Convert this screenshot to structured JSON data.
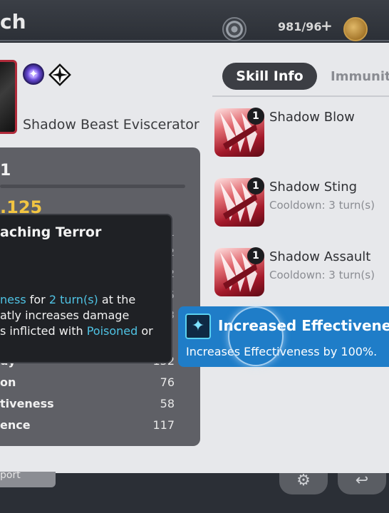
{
  "header": {
    "title_fragment": "ch",
    "stamina": "981/96",
    "plus_label": "+",
    "icons": [
      "settings-gear-icon",
      "gold-coin-icon"
    ]
  },
  "hero": {
    "name": "Shadow Beast Eviscerator",
    "badges": [
      "purple-star-badge-icon",
      "cross-diamond-badge-icon"
    ],
    "portrait_border_color": "#b02a3a"
  },
  "stats": {
    "level_fragment": "1",
    "combat_power_fragment": ".125",
    "rows": [
      {
        "label": "dy",
        "value": "152"
      },
      {
        "label": "on",
        "value": "76"
      },
      {
        "label": "tiveness",
        "value": "58"
      },
      {
        "label": "ence",
        "value": "117"
      }
    ],
    "peek_values": [
      "1",
      "2",
      "2",
      "5",
      "3"
    ]
  },
  "tooltip": {
    "title": "aching Terror",
    "line1_kw": "ness",
    "line1_mid": " for ",
    "line1_turns": "2 turn(s)",
    "line1_end": " at the",
    "line2": "atly increases damage",
    "line3_start": "s inflicted with ",
    "line3_kw": "Poisoned",
    "line3_end": " or"
  },
  "tabs": {
    "skill_info": "Skill Info",
    "immunity": "Immunity"
  },
  "skills": [
    {
      "name": "Shadow Blow",
      "level": "1",
      "cooldown": ""
    },
    {
      "name": "Shadow Sting",
      "level": "1",
      "cooldown": "Cooldown: 3 turn(s)"
    },
    {
      "name": "Shadow Assault",
      "level": "1",
      "cooldown": "Cooldown: 3 turn(s)"
    }
  ],
  "buff_popup": {
    "title": "Increased Effectiveness",
    "description": "Increases Effectiveness by 100%.",
    "icon": "effectiveness-buff-icon",
    "background_color": "#1f7dc8"
  },
  "footer": {
    "report_label": "port"
  },
  "colors": {
    "accent_keyword": "#4fc3e4",
    "combat_power": "#f2c542"
  }
}
